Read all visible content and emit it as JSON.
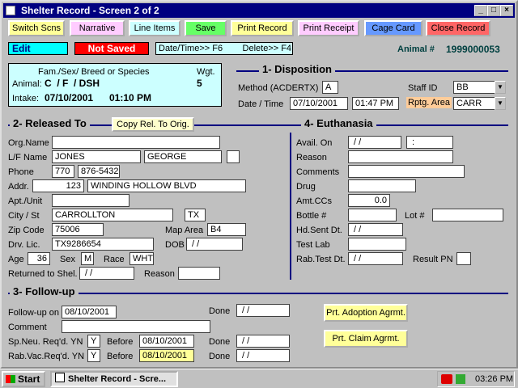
{
  "window": {
    "title": "Shelter Record - Screen 2 of 2"
  },
  "toolbar": {
    "switch": "Switch Scns",
    "narrative": "Narrative",
    "line_items": "Line Items",
    "save": "Save",
    "print_record": "Print Record",
    "print_receipt": "Print Receipt",
    "cage_card": "Cage Card",
    "close_record": "Close Record",
    "colors": {
      "switch": "#ffff99",
      "narrative": "#ffccff",
      "line_items": "#ccffff",
      "save": "#66ff66",
      "print_record": "#ffff99",
      "print_receipt": "#ffccff",
      "cage_card": "#6699ff",
      "close_record": "#ff6666"
    }
  },
  "status": {
    "mode": "Edit",
    "saved": "Not Saved",
    "hotkeys": "Date/Time>> F6        Delete>> F4",
    "animal_label": "Animal #",
    "animal_number": "1999000053"
  },
  "animal_box": {
    "fsb_label": "Fam./Sex/ Breed or Species",
    "wgt_label": "Wgt.",
    "animal_label": "Animal:",
    "animal_value": "C  / F  / DSH",
    "weight": "5",
    "intake_label": "Intake:",
    "intake_date": "07/10/2001",
    "intake_time": "01:10 PM"
  },
  "disposition": {
    "num": "1",
    "title": "- Disposition",
    "method_label": "Method (ACDERTX)",
    "method": "A",
    "datetime_label": "Date / Time",
    "date": "07/10/2001",
    "time": "01:47 PM",
    "staff_label": "Staff ID",
    "staff": "BB",
    "area_label": "Rptg. Area",
    "area": "CARR"
  },
  "released": {
    "num": "2",
    "title": "- Released  To",
    "copy_btn": "Copy Rel. To Orig.",
    "org_label": "Org.Name",
    "org": "",
    "name_label": "L/F Name",
    "last": "JONES",
    "first": "GEORGE",
    "mi": "",
    "phone_label": "Phone",
    "area_code": "770",
    "phone": "876-5432",
    "addr_label": "Addr.",
    "addr_num": "123",
    "addr_street": "WINDING HOLLOW BLVD",
    "apt_label": "Apt./Unit",
    "apt": "",
    "city_label": "City / St",
    "city": "CARROLLTON",
    "state": "TX",
    "zip_label": "Zip Code",
    "zip": "75006",
    "maparea_label": "Map Area",
    "maparea": "B4",
    "drv_label": "Drv. Lic.",
    "drv": "TX9286654",
    "dob_label": "DOB",
    "dob": " / /",
    "age_label": "Age",
    "age": "36",
    "sex_label": "Sex",
    "sex": "M",
    "race_label": "Race",
    "race": "WHT",
    "returned_label": "Returned to Shel.",
    "returned": " / /",
    "reason_label": "Reason",
    "reason": ""
  },
  "euthanasia": {
    "num": "4",
    "title": "- Euthanasia",
    "avail_label": "Avail. On",
    "avail_date": " / /",
    "avail_time": " :",
    "reason_label": "Reason",
    "comments_label": "Comments",
    "drug_label": "Drug",
    "amt_label": "Amt.CCs",
    "amt": "0.0",
    "bottle_label": "Bottle #",
    "lot_label": "Lot #",
    "hdsent_label": "Hd.Sent Dt.",
    "hdsent": " / /",
    "testlab_label": "Test Lab",
    "rabtest_label": "Rab.Test Dt.",
    "rabtest": " / /",
    "result_label": "Result PN"
  },
  "followup": {
    "num": "3",
    "title": "- Follow-up",
    "on_label": "Follow-up on",
    "on": "08/10/2001",
    "done_label": "Done",
    "done1": " / /",
    "comment_label": "Comment",
    "spneu_label": "Sp.Neu. Req'd. YN",
    "spneu": "Y",
    "before_label": "Before",
    "spneu_before": "08/10/2001",
    "done2": " / /",
    "rabvac_label": "Rab.Vac.Req'd. YN",
    "rabvac": "Y",
    "rabvac_before": "08/10/2001",
    "done3": " / /",
    "adoption_btn": "Prt. Adoption Agrmt.",
    "claim_btn": "Prt. Claim Agrmt."
  },
  "taskbar": {
    "start": "Start",
    "task": "Shelter Record - Scre...",
    "clock": "03:26 PM"
  }
}
